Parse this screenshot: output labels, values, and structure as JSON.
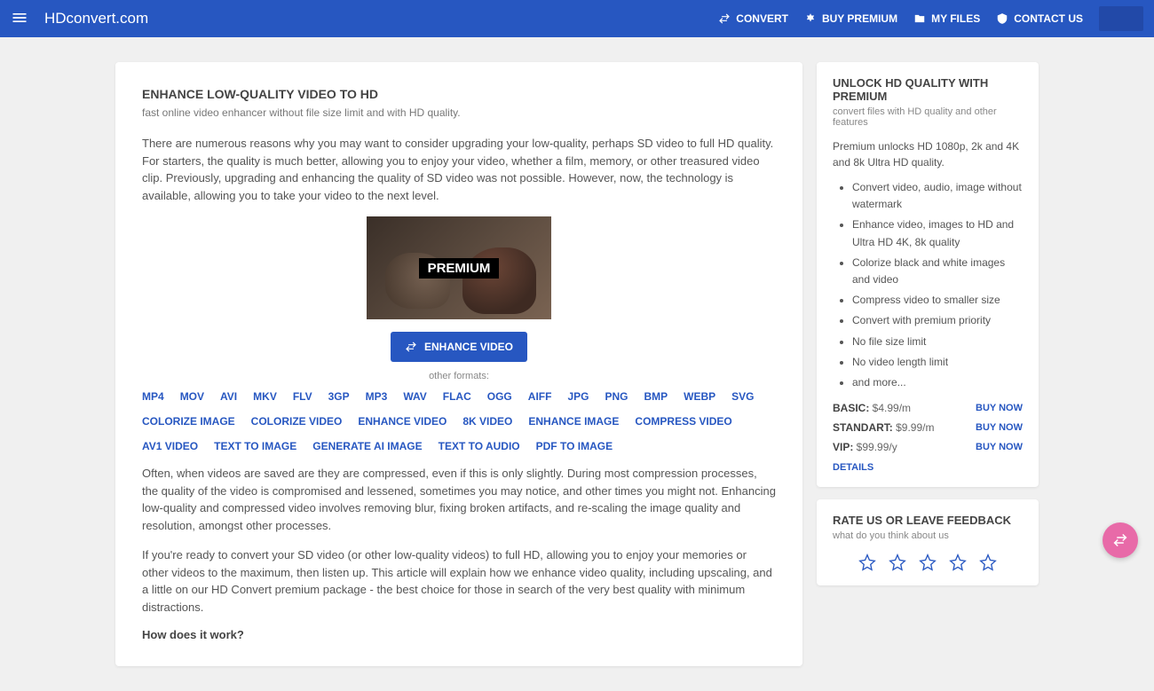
{
  "header": {
    "logo": "HDconvert.com",
    "nav": {
      "convert": "CONVERT",
      "buy_premium": "BUY PREMIUM",
      "my_files": "MY FILES",
      "contact_us": "CONTACT US"
    }
  },
  "main": {
    "title": "ENHANCE LOW-QUALITY VIDEO TO HD",
    "subtitle": "fast online video enhancer without file size limit and with HD quality.",
    "para1": "There are numerous reasons why you may want to consider upgrading your low-quality, perhaps SD video to full HD quality. For starters, the quality is much better, allowing you to enjoy your video, whether a film, memory, or other treasured video clip. Previously, upgrading and enhancing the quality of SD video was not possible. However, now, the technology is available, allowing you to take your video to the next level.",
    "premium_tag": "PREMIUM",
    "enhance_btn": "ENHANCE VIDEO",
    "other_formats_label": "other formats:",
    "formats_row1": [
      "MP4",
      "MOV",
      "AVI",
      "MKV",
      "FLV",
      "3GP",
      "MP3",
      "WAV",
      "FLAC",
      "OGG",
      "AIFF",
      "JPG",
      "PNG",
      "BMP",
      "WEBP",
      "SVG"
    ],
    "formats_row2": [
      "COLORIZE IMAGE",
      "COLORIZE VIDEO",
      "ENHANCE VIDEO",
      "8K VIDEO",
      "ENHANCE IMAGE",
      "COMPRESS VIDEO"
    ],
    "formats_row3": [
      "AV1 VIDEO",
      "TEXT TO IMAGE",
      "GENERATE AI IMAGE",
      "TEXT TO AUDIO",
      "PDF TO IMAGE"
    ],
    "para2": "Often, when videos are saved are they are compressed, even if this is only slightly. During most compression processes, the quality of the video is compromised and lessened, sometimes you may notice, and other times you might not. Enhancing low-quality and compressed video involves removing blur, fixing broken artifacts, and re-scaling the image quality and resolution, amongst other processes.",
    "para3": "If you're ready to convert your SD video (or other low-quality videos) to full HD, allowing you to enjoy your memories or other videos to the maximum, then listen up. This article will explain how we enhance video quality, including upscaling, and a little on our HD Convert premium package - the best choice for those in search of the very best quality with minimum distractions.",
    "how_title": "How does it work?"
  },
  "premium_card": {
    "title": "UNLOCK HD QUALITY WITH PREMIUM",
    "subtitle": "convert files with HD quality and other features",
    "desc": "Premium unlocks HD 1080p, 2k and 4K and 8k Ultra HD quality.",
    "features": [
      "Convert video, audio, image without watermark",
      "Enhance video, images to HD and Ultra HD 4K, 8k quality",
      "Colorize black and white images and video",
      "Compress video to smaller size",
      "Convert with premium priority",
      "No file size limit",
      "No video length limit",
      "and more..."
    ],
    "plans": [
      {
        "name": "BASIC:",
        "price": "$4.99/m",
        "btn": "BUY NOW"
      },
      {
        "name": "STANDART:",
        "price": "$9.99/m",
        "btn": "BUY NOW"
      },
      {
        "name": "VIP:",
        "price": "$99.99/y",
        "btn": "BUY NOW"
      }
    ],
    "details": "DETAILS"
  },
  "rate_card": {
    "title": "RATE US OR LEAVE FEEDBACK",
    "subtitle": "what do you think about us"
  }
}
